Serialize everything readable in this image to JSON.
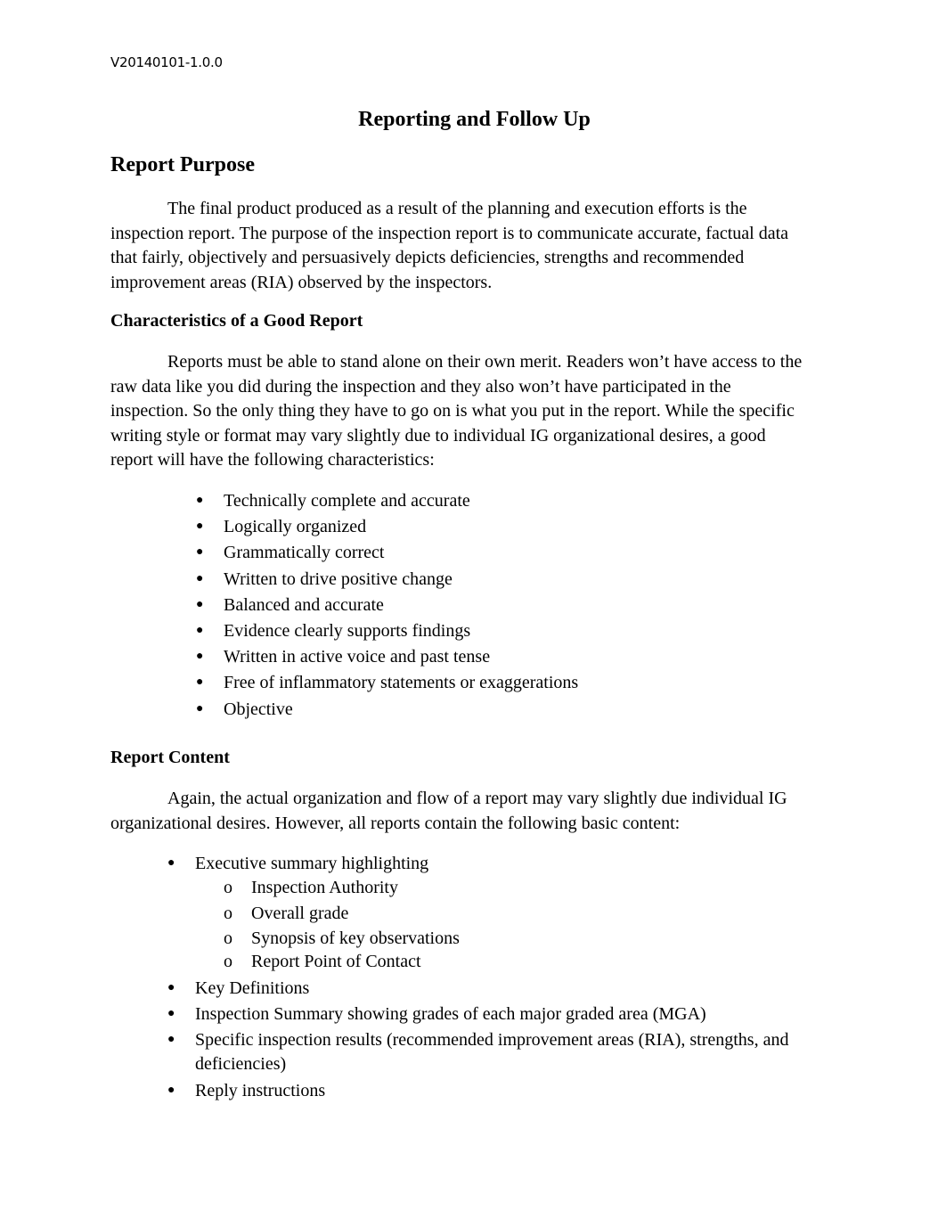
{
  "header": {
    "version": "V20140101-1.0.0"
  },
  "document": {
    "title": "Reporting and Follow Up",
    "sections": [
      {
        "heading": "Report Purpose",
        "paragraph_lines": [
          "The final product produced as a result of the planning and execution efforts is the",
          "inspection report. The purpose of the inspection report is to communicate accurate, factual data",
          "that fairly, objectively and persuasively depicts deficiencies, strengths and recommended",
          "improvement areas (RIA) observed by the inspectors."
        ]
      },
      {
        "heading": "Characteristics of a Good Report",
        "paragraph_lines": [
          "Reports must be able to stand alone on their own merit. Readers won’t have access to the",
          "raw data like you did during the inspection and they also won’t have participated in the",
          "inspection. So the only thing they have to go on is what you put in the report. While the specific",
          "writing style or format may vary slightly due to individual IG organizational desires, a good",
          "report will have the following characteristics:"
        ],
        "bullets": [
          "Technically complete and accurate",
          "Logically organized",
          "Grammatically correct",
          "Written to drive positive change",
          "Balanced and accurate",
          "Evidence clearly supports findings",
          "Written in active voice and past tense",
          "Free of inflammatory statements or exaggerations",
          "Objective"
        ]
      },
      {
        "heading": "Report Content",
        "paragraph_lines": [
          "Again, the actual organization and flow of a report may vary slightly due individual IG",
          "organizational desires. However, all reports contain the following basic content:"
        ],
        "bullets": [
          {
            "text": "Executive summary highlighting",
            "sub": [
              "Inspection Authority",
              "Overall grade",
              "Synopsis of key observations",
              "Report Point of Contact"
            ]
          },
          {
            "text": "Key Definitions"
          },
          {
            "text": "Inspection Summary showing grades of each major graded area (MGA)"
          },
          {
            "text_lines": [
              "Specific  inspection results (recommended improvement areas (RIA), strengths, and",
              "deficiencies)"
            ]
          },
          {
            "text": "Reply instructions"
          }
        ]
      }
    ]
  },
  "glyphs": {
    "bullet": "●",
    "sub_bullet": "o"
  }
}
